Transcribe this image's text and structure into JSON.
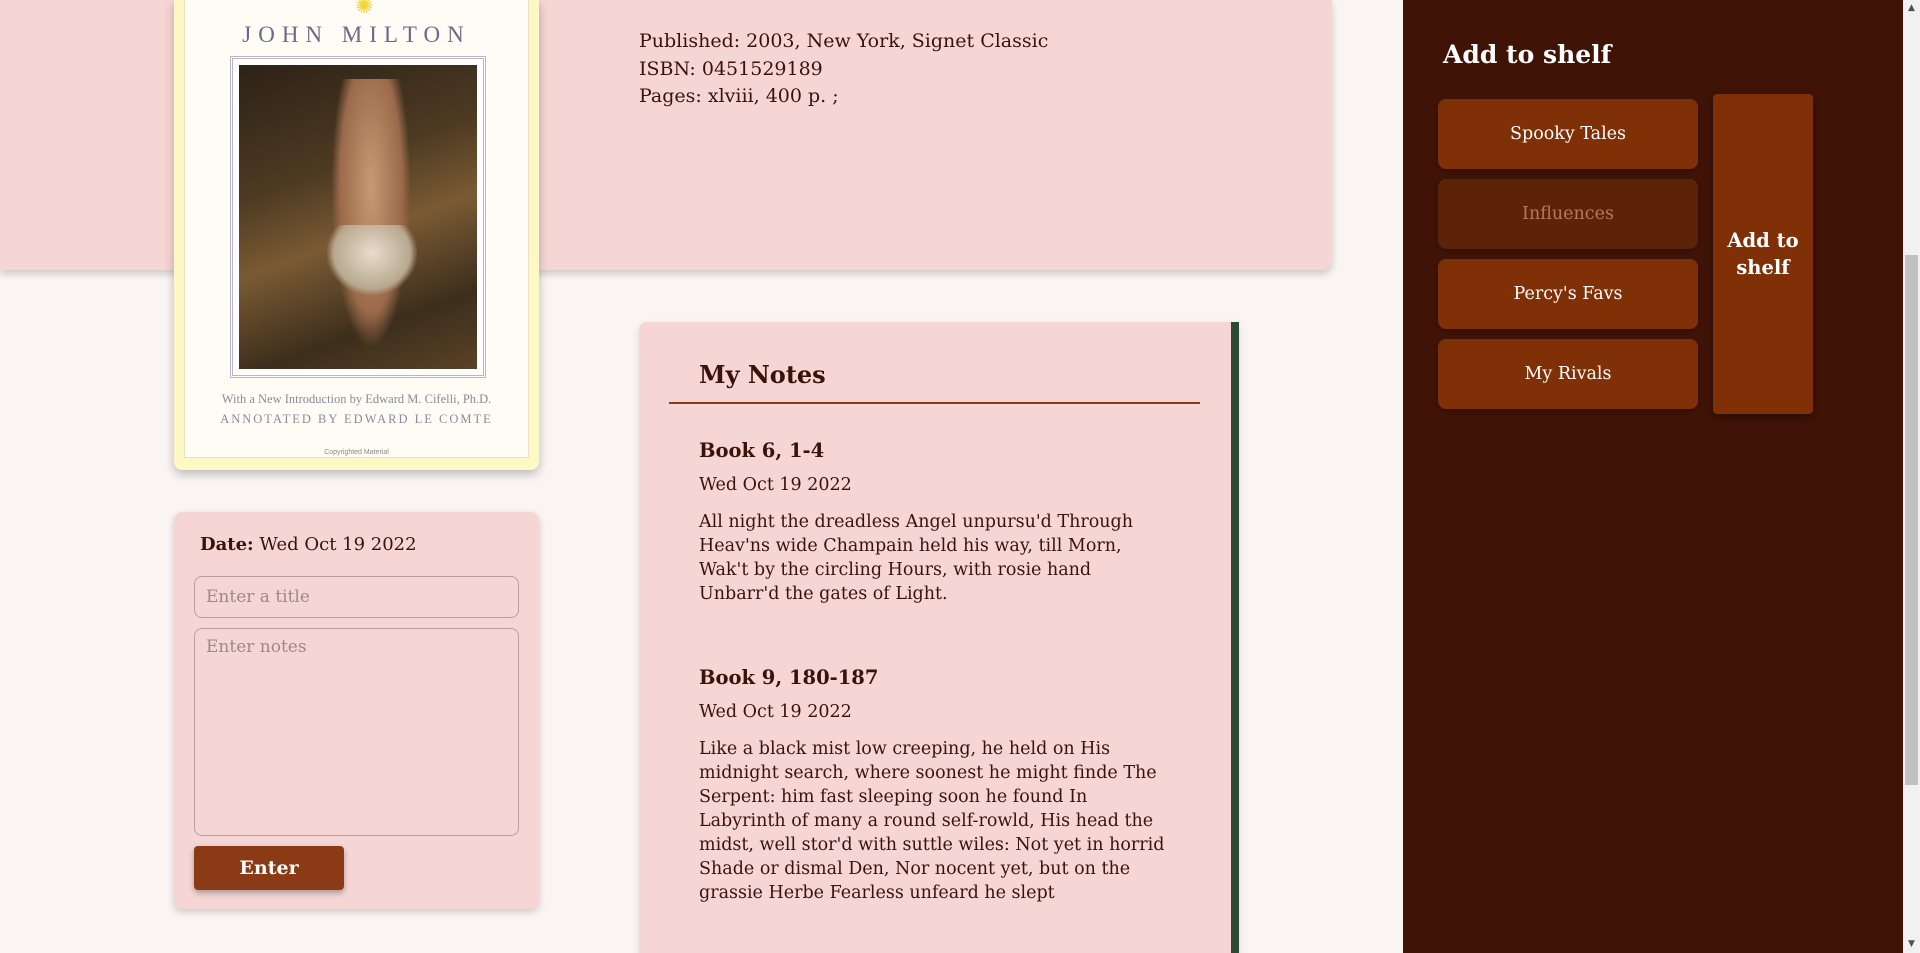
{
  "book": {
    "published": "Published: 2003, New York, Signet Classic",
    "isbn": "ISBN: 0451529189",
    "pages": "Pages: xlviii, 400 p. ;",
    "cover": {
      "author": "JOHN MILTON",
      "intro": "With a New Introduction by Edward M. Cifelli, Ph.D.",
      "annotated": "ANNOTATED BY EDWARD LE COMTE",
      "copyright": "Copyrighted Material"
    }
  },
  "note_form": {
    "date_label": "Date:",
    "date_value": "Wed Oct 19 2022",
    "title_placeholder": "Enter a title",
    "notes_placeholder": "Enter notes",
    "enter_label": "Enter"
  },
  "notes": {
    "heading": "My Notes",
    "items": [
      {
        "title": "Book 6, 1-4",
        "date": "Wed Oct 19 2022",
        "body": "All night the dreadless Angel unpursu'd Through Heav'ns wide Champain held his way, till Morn, Wak't by the circling Hours, with rosie hand Unbarr'd the gates of Light."
      },
      {
        "title": "Book 9, 180-187",
        "date": "Wed Oct 19 2022",
        "body": "Like a black mist low creeping, he held on His midnight search, where soonest he might finde The Serpent: him fast sleeping soon he found In Labyrinth of many a round self-rowld, His head the midst, well stor'd with suttle wiles: Not yet in horrid Shade or dismal Den, Nor nocent yet, but on the grassie Herbe Fearless unfeard he slept"
      }
    ]
  },
  "sidebar": {
    "title": "Add to shelf",
    "shelves": [
      {
        "label": "Spooky Tales",
        "selected": false
      },
      {
        "label": "Influences",
        "selected": true
      },
      {
        "label": "Percy's Favs",
        "selected": false
      },
      {
        "label": "My Rivals",
        "selected": false
      }
    ],
    "add_button": "Add to shelf"
  },
  "colors": {
    "card_pink": "#f6d6d4",
    "sidebar_bg": "#3f1306",
    "button_brown": "#7f3007",
    "accent_green": "#2e4a36"
  }
}
